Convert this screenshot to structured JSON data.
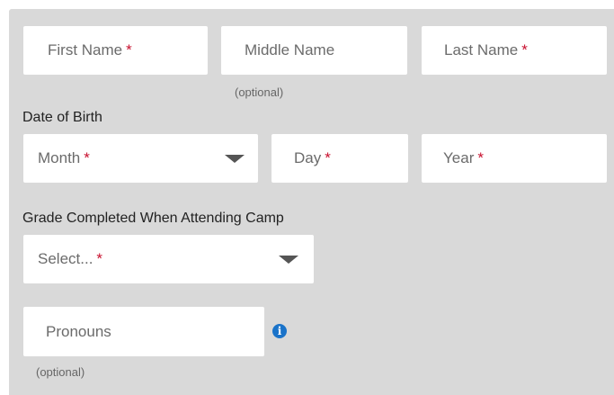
{
  "name_row": {
    "first_name_placeholder": "First Name",
    "middle_name_placeholder": "Middle Name",
    "last_name_placeholder": "Last Name",
    "middle_hint": "(optional)"
  },
  "dob": {
    "label": "Date of Birth",
    "month_placeholder": "Month",
    "day_placeholder": "Day",
    "year_placeholder": "Year"
  },
  "grade": {
    "label": "Grade Completed When Attending Camp",
    "select_placeholder": "Select..."
  },
  "pronouns": {
    "placeholder": "Pronouns",
    "hint": "(optional)",
    "info_icon": "info-icon"
  },
  "required_marker": "*",
  "colors": {
    "panel_bg": "#d9d9d9",
    "required": "#c8102e",
    "info": "#1a73c9"
  }
}
